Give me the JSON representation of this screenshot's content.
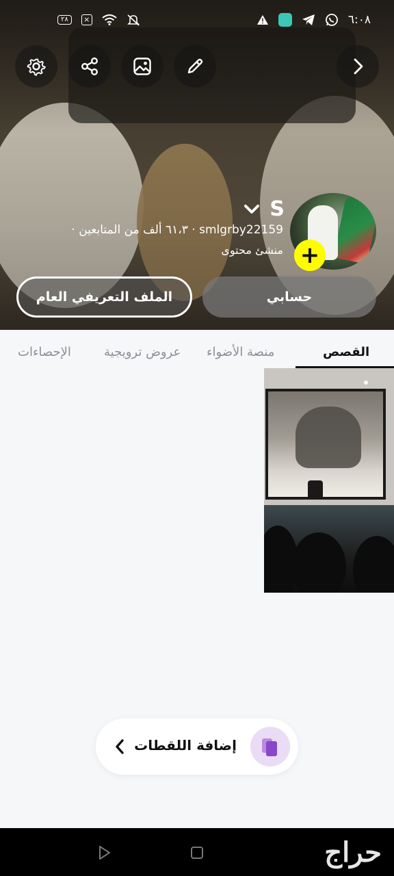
{
  "status_bar": {
    "time": "٦:٠٨",
    "battery": "٢٨"
  },
  "profile": {
    "display_name": "S",
    "username": "smlgrby22159",
    "followers": "٦١،٣ ألف من المتابعين",
    "separator": "·",
    "role": "منشئ محتوى"
  },
  "buttons": {
    "account": "حسابي",
    "public_profile": "الملف التعريفي العام",
    "add_story": "+"
  },
  "tabs": [
    {
      "label": "القصص",
      "active": true
    },
    {
      "label": "منصة الأضواء",
      "active": false
    },
    {
      "label": "عروض ترويجية",
      "active": false
    },
    {
      "label": "الإحصاءات",
      "active": false
    }
  ],
  "add_snaps": {
    "label": "إضافة اللقطات"
  },
  "watermark": "حراج",
  "icons": {
    "settings": "gear-icon",
    "share": "share-icon",
    "image": "image-icon",
    "edit": "pencil-icon",
    "forward": "chevron-right-icon"
  },
  "colors": {
    "snap_yellow": "#fffc00",
    "icon_purple": "#8a47c8"
  }
}
